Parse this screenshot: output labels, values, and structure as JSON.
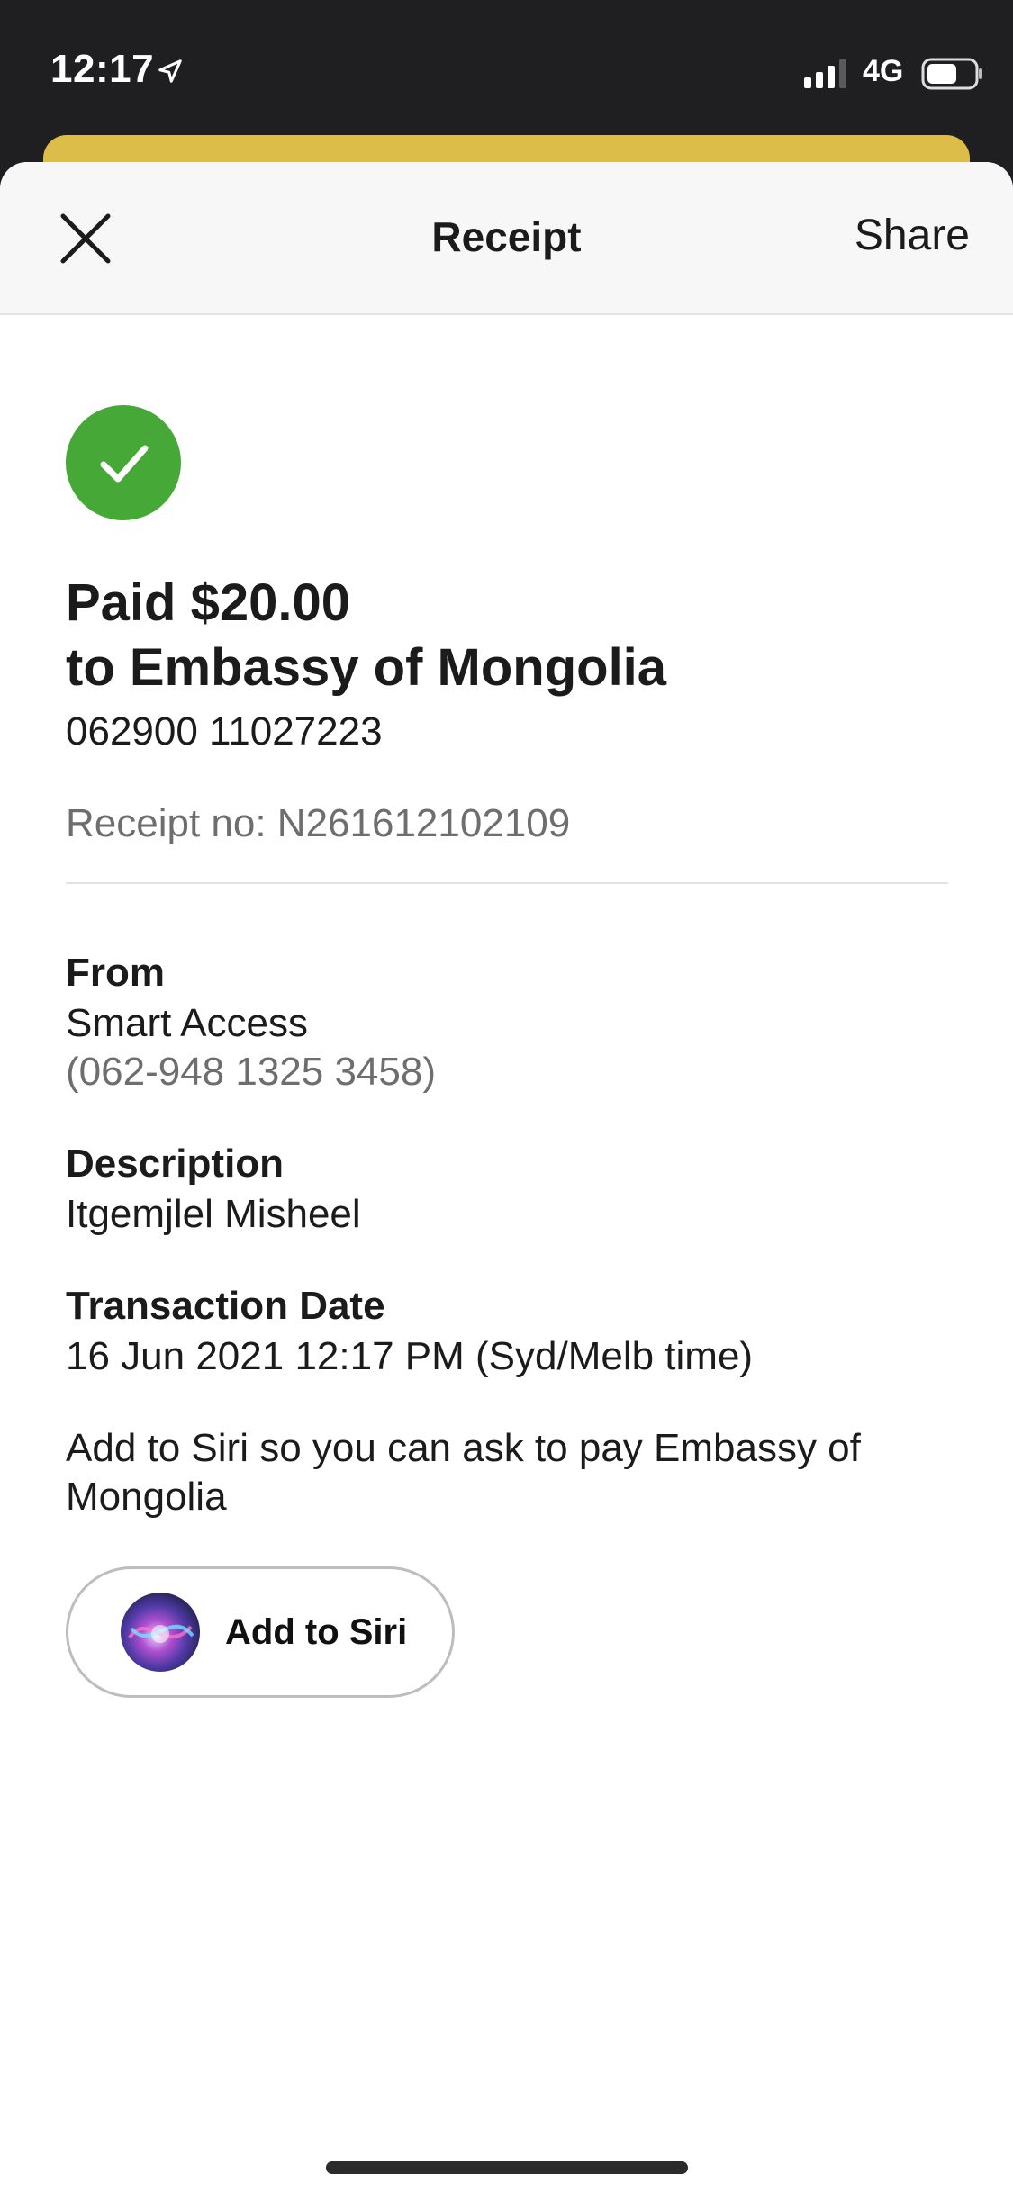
{
  "status_bar": {
    "time": "12:17",
    "network": "4G"
  },
  "header": {
    "title": "Receipt",
    "share_label": "Share"
  },
  "payment": {
    "paid_line": "Paid $20.00",
    "to_line": "to Embassy of Mongolia",
    "account": "062900 11027223",
    "receipt_no": "Receipt no: N261612102109"
  },
  "details": {
    "from_label": "From",
    "from_account_name": "Smart Access",
    "from_account_number": "(062-948 1325 3458)",
    "description_label": "Description",
    "description_value": "Itgemjlel Misheel",
    "date_label": "Transaction Date",
    "date_value": "16 Jun 2021 12:17 PM (Syd/Melb time)"
  },
  "siri": {
    "prompt": "Add to Siri so you can ask to pay Embassy of Mongolia",
    "button_label": "Add to Siri"
  },
  "colors": {
    "success": "#46a836",
    "accent_peek": "#ddbd4a",
    "status_bar_bg": "#1f1f21"
  }
}
